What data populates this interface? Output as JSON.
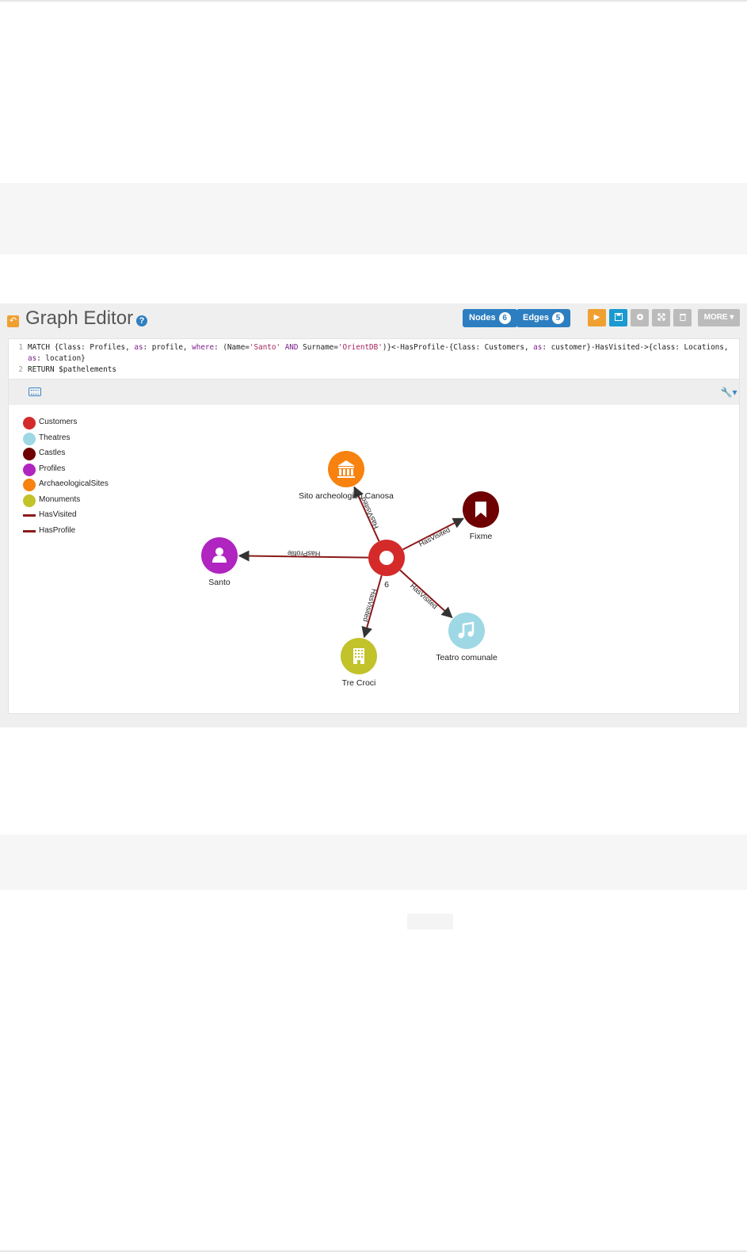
{
  "editor": {
    "title": "Graph Editor",
    "nodes_label": "Nodes",
    "nodes_count": "6",
    "edges_label": "Edges",
    "edges_count": "5",
    "more_label": "MORE ▾",
    "query_lines": [
      {
        "num": "1",
        "text": "MATCH {Class: Profiles, as: profile, where: (Name='Santo' AND Surname='OrientDB')}<-HasProfile-{Class: Customers, as: customer}-HasVisited->{class: Locations,"
      },
      {
        "num": "",
        "text": "as: location}"
      },
      {
        "num": "2",
        "text": "RETURN $pathelements"
      }
    ]
  },
  "legend": [
    {
      "label": "Customers",
      "color": "#d42a2a",
      "kind": "node"
    },
    {
      "label": "Theatres",
      "color": "#9ed8e4",
      "kind": "node"
    },
    {
      "label": "Castles",
      "color": "#6e0000",
      "kind": "node"
    },
    {
      "label": "Profiles",
      "color": "#b024c0",
      "kind": "node"
    },
    {
      "label": "ArchaeologicalSites",
      "color": "#f7820f",
      "kind": "node"
    },
    {
      "label": "Monuments",
      "color": "#c2c22a",
      "kind": "node"
    },
    {
      "label": "HasVisited",
      "color": "#8b1a1a",
      "kind": "edge"
    },
    {
      "label": "HasProfile",
      "color": "#8b1a1a",
      "kind": "edge"
    }
  ],
  "graph": {
    "nodes": [
      {
        "id": "customer",
        "label": "6",
        "class": "Customers",
        "color": "#d42a2a",
        "icon": "circle-icon"
      },
      {
        "id": "site",
        "label": "Sito archeologico Canosa",
        "class": "ArchaeologicalSites",
        "color": "#f7820f",
        "icon": "museum-icon"
      },
      {
        "id": "fixme",
        "label": "Fixme",
        "class": "Castles",
        "color": "#6e0000",
        "icon": "bookmark-icon"
      },
      {
        "id": "santo",
        "label": "Santo",
        "class": "Profiles",
        "color": "#b024c0",
        "icon": "user-icon"
      },
      {
        "id": "teatro",
        "label": "Teatro comunale",
        "class": "Theatres",
        "color": "#9ed8e4",
        "icon": "music-icon"
      },
      {
        "id": "trecroci",
        "label": "Tre Croci",
        "class": "Monuments",
        "color": "#c2c22a",
        "icon": "building-icon"
      }
    ],
    "edges": [
      {
        "from": "customer",
        "to": "site",
        "label": "HasVisited"
      },
      {
        "from": "customer",
        "to": "fixme",
        "label": "HasVisited"
      },
      {
        "from": "customer",
        "to": "santo",
        "label": "HasProfile"
      },
      {
        "from": "customer",
        "to": "teatro",
        "label": "HasVisited"
      },
      {
        "from": "customer",
        "to": "trecroci",
        "label": "HasVisited"
      }
    ]
  }
}
